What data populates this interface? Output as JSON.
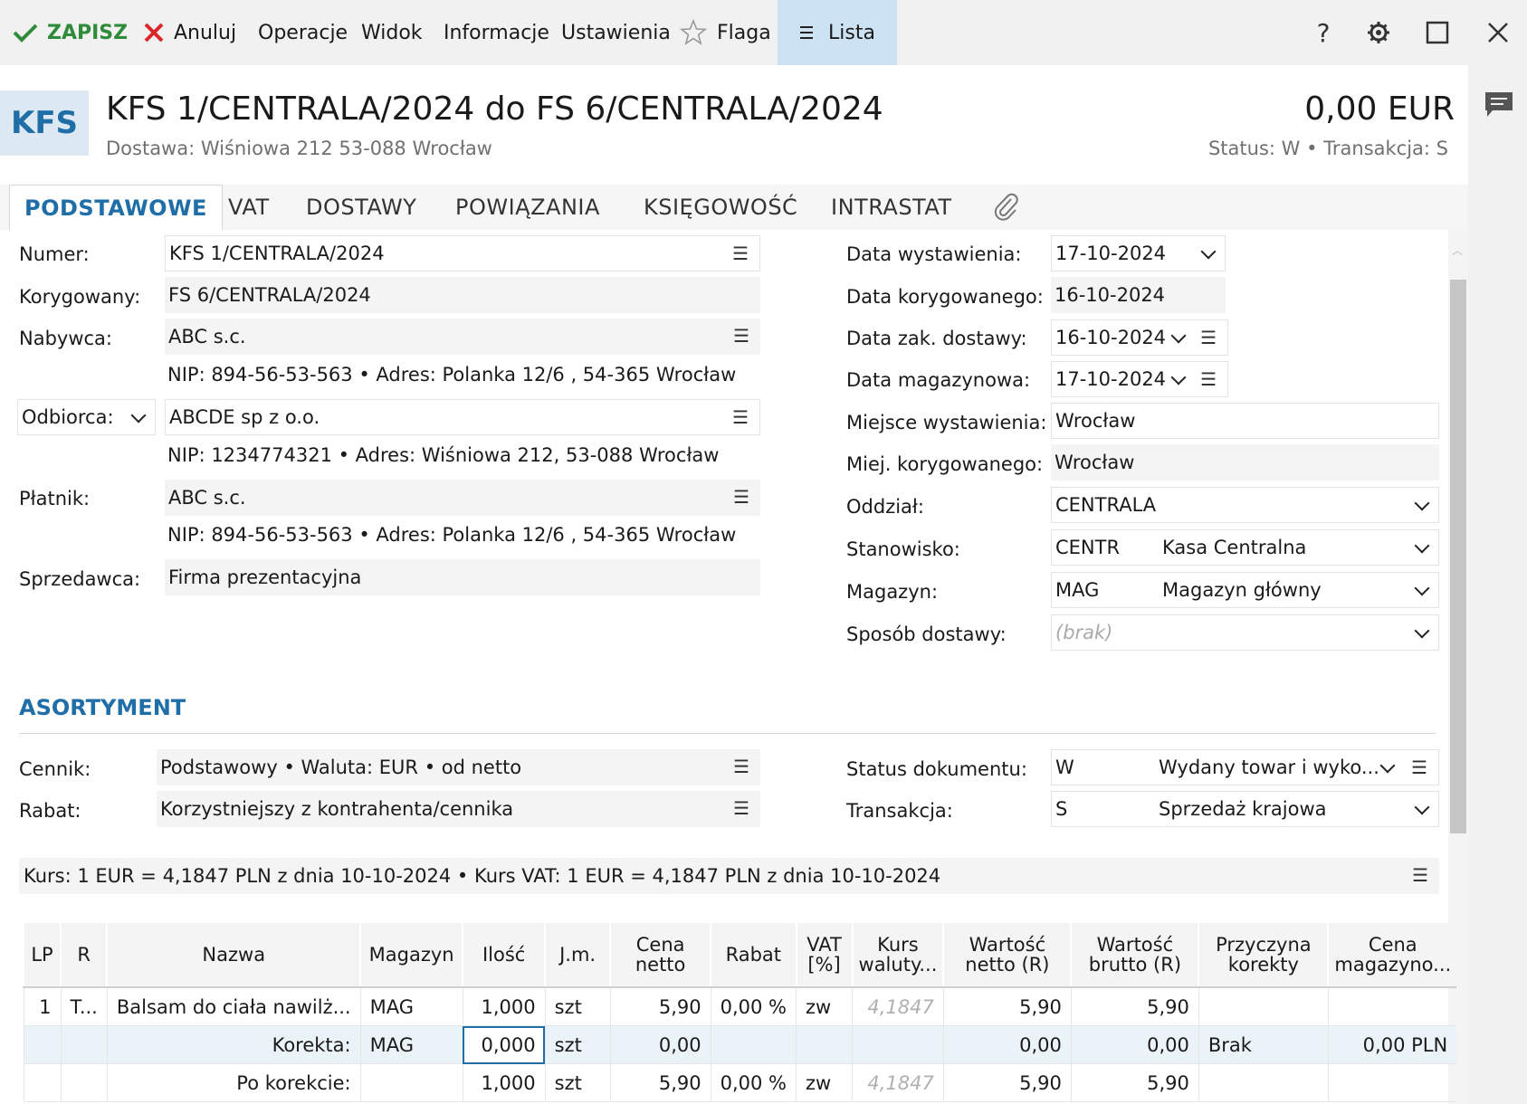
{
  "toolbar": {
    "save": "ZAPISZ",
    "cancel": "Anuluj",
    "operations": "Operacje",
    "view": "Widok",
    "information": "Informacje",
    "settings": "Ustawienia",
    "flag": "Flaga",
    "list": "Lista",
    "help": "?"
  },
  "document": {
    "badge": "KFS",
    "title": "KFS 1/CENTRALA/2024 do FS 6/CENTRALA/2024",
    "subtitle": "Dostawa: Wiśniowa 212 53-088 Wrocław",
    "amount": "0,00 EUR",
    "status_line": "Status:  W  •  Transakcja:  S"
  },
  "tabs": [
    "PODSTAWOWE",
    "VAT",
    "DOSTAWY",
    "POWIĄZANIA",
    "KSIĘGOWOŚĆ",
    "INTRASTAT"
  ],
  "form_left": {
    "numer_label": "Numer:",
    "numer_value": "KFS 1/CENTRALA/2024",
    "korygowany_label": "Korygowany:",
    "korygowany_value": "FS 6/CENTRALA/2024",
    "nabywca_label": "Nabywca:",
    "nabywca_value": "ABC s.c.",
    "nabywca_info": "NIP:  894-56-53-563  •  Adres:  Polanka  12/6 , 54-365 Wrocław",
    "odbiorca_label": "Odbiorca:",
    "odbiorca_value": "ABCDE sp z o.o.",
    "odbiorca_info": "NIP:  1234774321  •  Adres:  Wiśniowa 212, 53-088 Wrocław",
    "platnik_label": "Płatnik:",
    "platnik_value": "ABC s.c.",
    "platnik_info": "NIP:  894-56-53-563  •  Adres:  Polanka  12/6 , 54-365 Wrocław",
    "sprzedawca_label": "Sprzedawca:",
    "sprzedawca_value": "Firma prezentacyjna"
  },
  "form_right": {
    "data_wyst_label": "Data wystawienia:",
    "data_wyst_value": "17-10-2024",
    "data_kor_label": "Data korygowanego:",
    "data_kor_value": "16-10-2024",
    "data_zak_label": "Data zak. dostawy:",
    "data_zak_value": "16-10-2024",
    "data_mag_label": "Data magazynowa:",
    "data_mag_value": "17-10-2024",
    "miejsce_label": "Miejsce wystawienia:",
    "miejsce_value": "Wrocław",
    "miej_kor_label": "Miej. korygowanego:",
    "miej_kor_value": "Wrocław",
    "oddzial_label": "Oddział:",
    "oddzial_value": "CENTRALA",
    "stanowisko_label": "Stanowisko:",
    "stanowisko_code": "CENTR",
    "stanowisko_name": "Kasa Centralna",
    "magazyn_label": "Magazyn:",
    "magazyn_code": "MAG",
    "magazyn_name": "Magazyn główny",
    "sposob_label": "Sposób dostawy:",
    "sposob_placeholder": "(brak)"
  },
  "assortment": {
    "title": "ASORTYMENT",
    "cennik_label": "Cennik:",
    "cennik_value": "Podstawowy • Waluta: EUR • od netto",
    "rabat_label": "Rabat:",
    "rabat_value": "Korzystniejszy z kontrahenta/cennika",
    "status_label": "Status dokumentu:",
    "status_code": "W",
    "status_name": "Wydany towar i wyko...",
    "transakcja_label": "Transakcja:",
    "transakcja_code": "S",
    "transakcja_name": "Sprzedaż krajowa",
    "kurs": "Kurs: 1 EUR = 4,1847 PLN z dnia 10-10-2024   •   Kurs VAT: 1 EUR = 4,1847 PLN z dnia 10-10-2024"
  },
  "grid": {
    "headers": [
      "LP",
      "R",
      "Nazwa",
      "Magazyn",
      "Ilość",
      "J.m.",
      "Cena netto",
      "Rabat",
      "VAT [%]",
      "Kurs waluty...",
      "Wartość netto (R)",
      "Wartość brutto (R)",
      "Przyczyna korekty",
      "Cena magazyno..."
    ],
    "rows": [
      [
        "1",
        "T...",
        "Balsam do ciała nawilż...",
        "MAG",
        "1,000",
        "szt",
        "5,90",
        "0,00 %",
        "zw",
        "4,1847",
        "5,90",
        "5,90",
        "",
        ""
      ],
      [
        "",
        "",
        "Korekta:",
        "MAG",
        "0,000",
        "szt",
        "0,00",
        "",
        "",
        "",
        "0,00",
        "0,00",
        "Brak",
        "0,00 PLN"
      ],
      [
        "",
        "",
        "Po korekcie:",
        "",
        "1,000",
        "szt",
        "5,90",
        "0,00 %",
        "zw",
        "4,1847",
        "5,90",
        "5,90",
        "",
        ""
      ]
    ]
  },
  "colors": {
    "accent": "#1f6ea8",
    "save_green": "#2e8b3a",
    "cancel_red": "#d9262a",
    "list_active": "#cde3f3"
  }
}
